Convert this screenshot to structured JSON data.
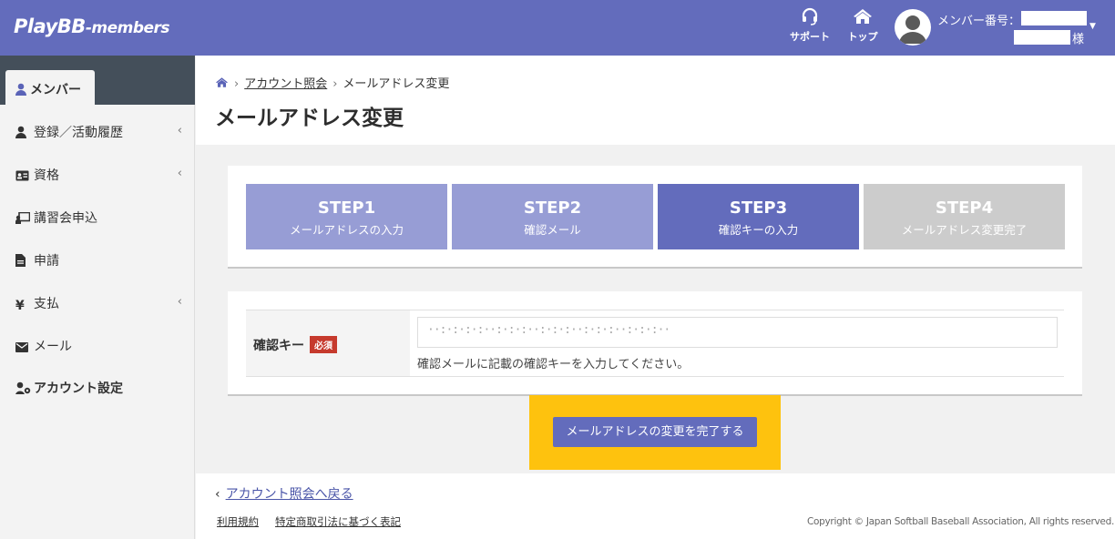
{
  "header": {
    "logo_main": "PlayBB",
    "logo_sub": "-members",
    "support_label": "サポート",
    "top_label": "トップ",
    "member_label": "メンバー番号：",
    "sama": "様",
    "bg_color": "#636cbc"
  },
  "sidebar": {
    "active": "メンバー",
    "items": [
      {
        "label": "登録／活動履歴",
        "icon": "user-icon",
        "has_chevron": true
      },
      {
        "label": "資格",
        "icon": "id-card-icon",
        "has_chevron": true
      },
      {
        "label": "講習会申込",
        "icon": "chalkboard-icon",
        "has_chevron": false
      },
      {
        "label": "申請",
        "icon": "file-icon",
        "has_chevron": false
      },
      {
        "label": "支払",
        "icon": "yen-icon",
        "has_chevron": true
      },
      {
        "label": "メール",
        "icon": "envelope-icon",
        "has_chevron": false
      },
      {
        "label": "アカウント設定",
        "icon": "user-cog-icon",
        "has_chevron": false
      }
    ],
    "chevron": "‹"
  },
  "breadcrumb": {
    "link": "アカウント照会",
    "current": "メールアドレス変更"
  },
  "page_title": "メールアドレス変更",
  "steps": [
    {
      "title": "STEP1",
      "desc": "メールアドレスの入力",
      "color": "#979dd5"
    },
    {
      "title": "STEP2",
      "desc": "確認メール",
      "color": "#979dd5"
    },
    {
      "title": "STEP3",
      "desc": "確認キーの入力",
      "color": "#636cbc"
    },
    {
      "title": "STEP4",
      "desc": "メールアドレス変更完了",
      "color": "#cccccc"
    }
  ],
  "form": {
    "label": "確認キー",
    "required": "必須",
    "input_value": "··:·:·:·:··:·:·:··:·:·:··:·:·:··:·:·:··",
    "help": "確認メールに記載の確認キーを入力してください。"
  },
  "submit_label": "メールアドレスの変更を完了する",
  "footer": {
    "back": "アカウント照会へ戻る",
    "terms": "利用規約",
    "tokutei": "特定商取引法に基づく表記",
    "copyright": "Copyright © Japan Softball Baseball Association, All rights reserved."
  }
}
